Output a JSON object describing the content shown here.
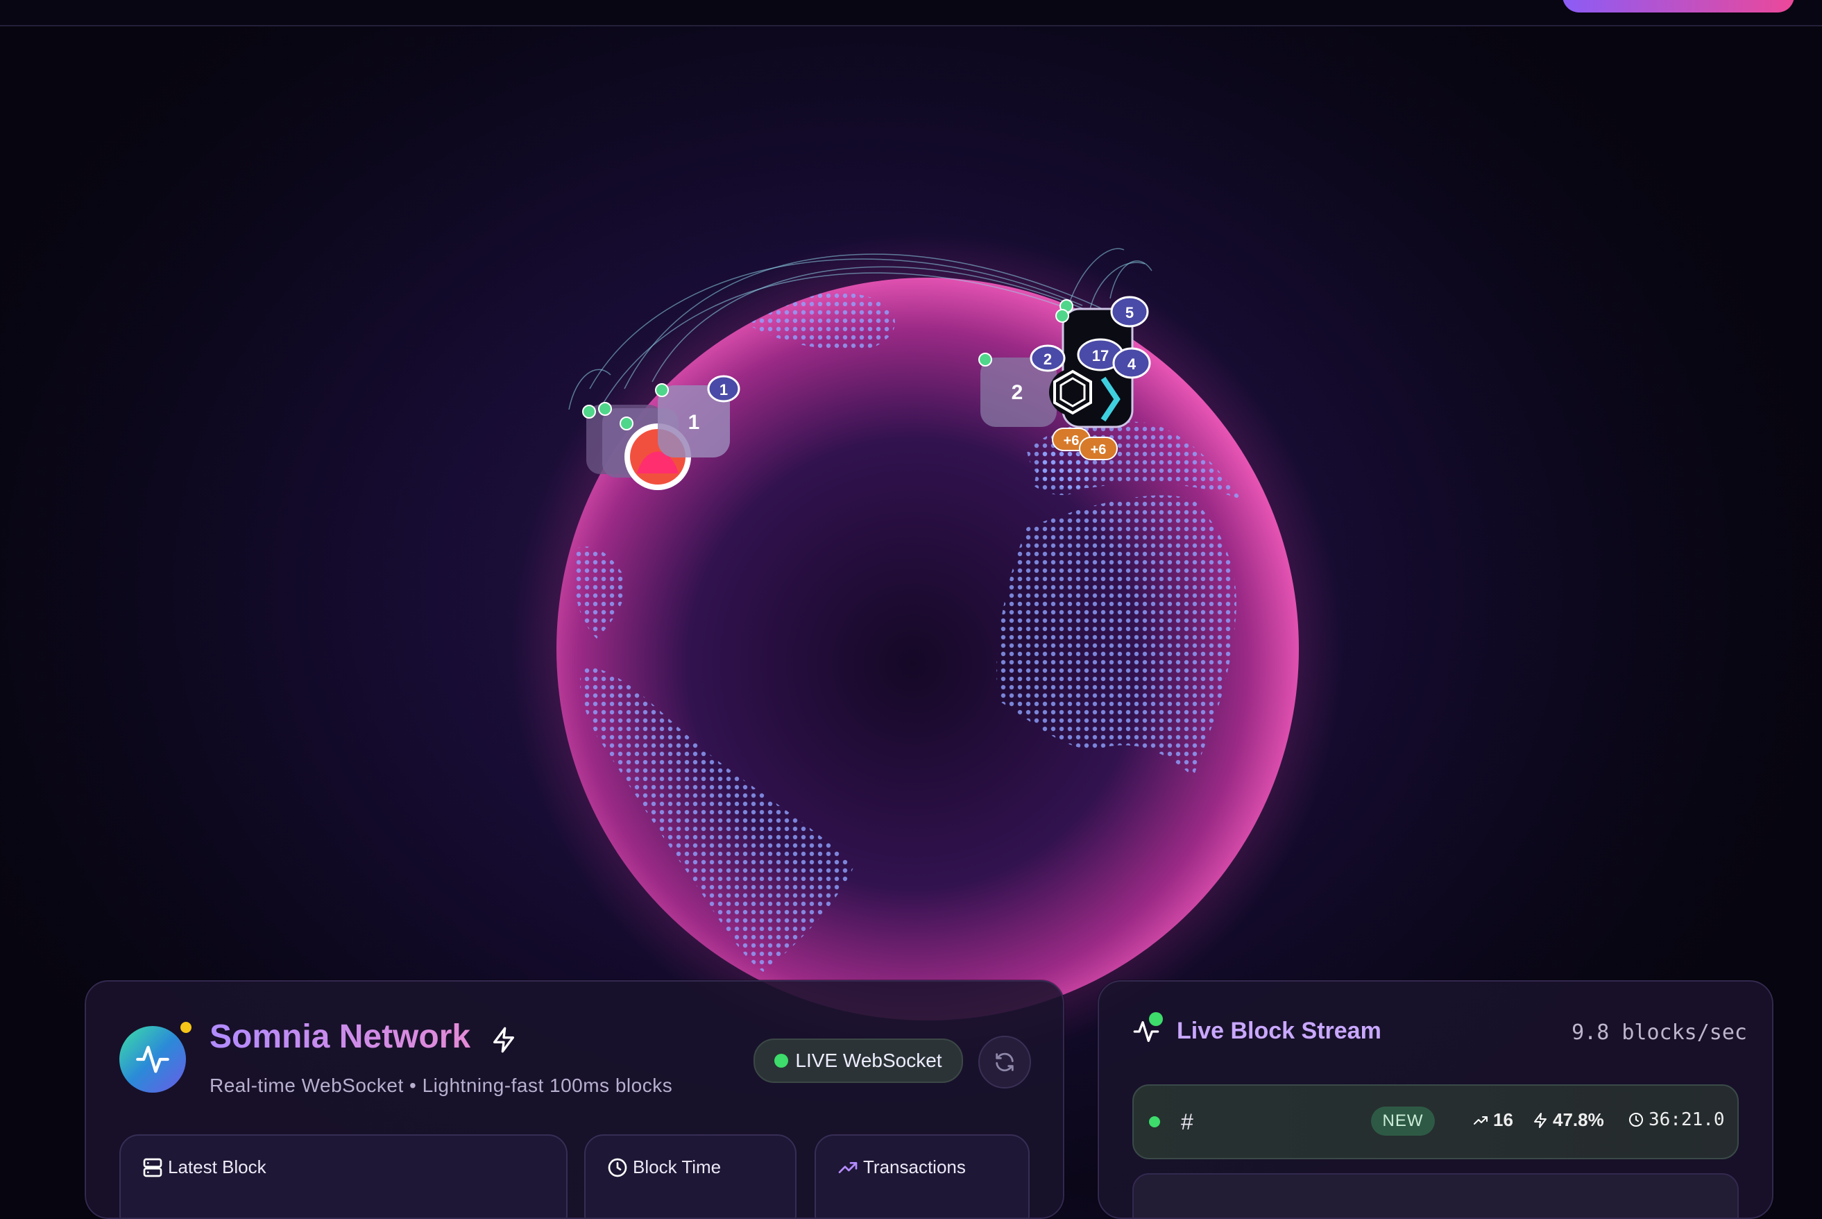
{
  "network": {
    "title": "Somnia Network",
    "subtitle": "Real-time WebSocket • Lightning-fast 100ms blocks",
    "live_label": "LIVE WebSocket"
  },
  "stats": [
    {
      "label": "Latest Block",
      "icon": "server-icon"
    },
    {
      "label": "Block Time",
      "icon": "clock-icon"
    },
    {
      "label": "Transactions",
      "icon": "trending-up-icon"
    }
  ],
  "stream": {
    "title": "Live Block Stream",
    "rate": "9.8 blocks/sec",
    "latest": {
      "hash": "#",
      "badge": "NEW",
      "tx": "16",
      "gas": "47.8%",
      "time": "36:21.0"
    }
  },
  "globe": {
    "clusters": [
      {
        "count": "1"
      },
      {
        "count": "1"
      },
      {
        "count": "2"
      },
      {
        "count": "2"
      },
      {
        "count": "17"
      },
      {
        "count": "5"
      },
      {
        "count": "4"
      },
      {
        "count": "+6"
      },
      {
        "count": "+6"
      }
    ]
  },
  "colors": {
    "accent_purple": "#8b5cf6",
    "accent_pink": "#ec4899",
    "live_green": "#3ddc6b",
    "globe_pink": "#e6389c"
  }
}
